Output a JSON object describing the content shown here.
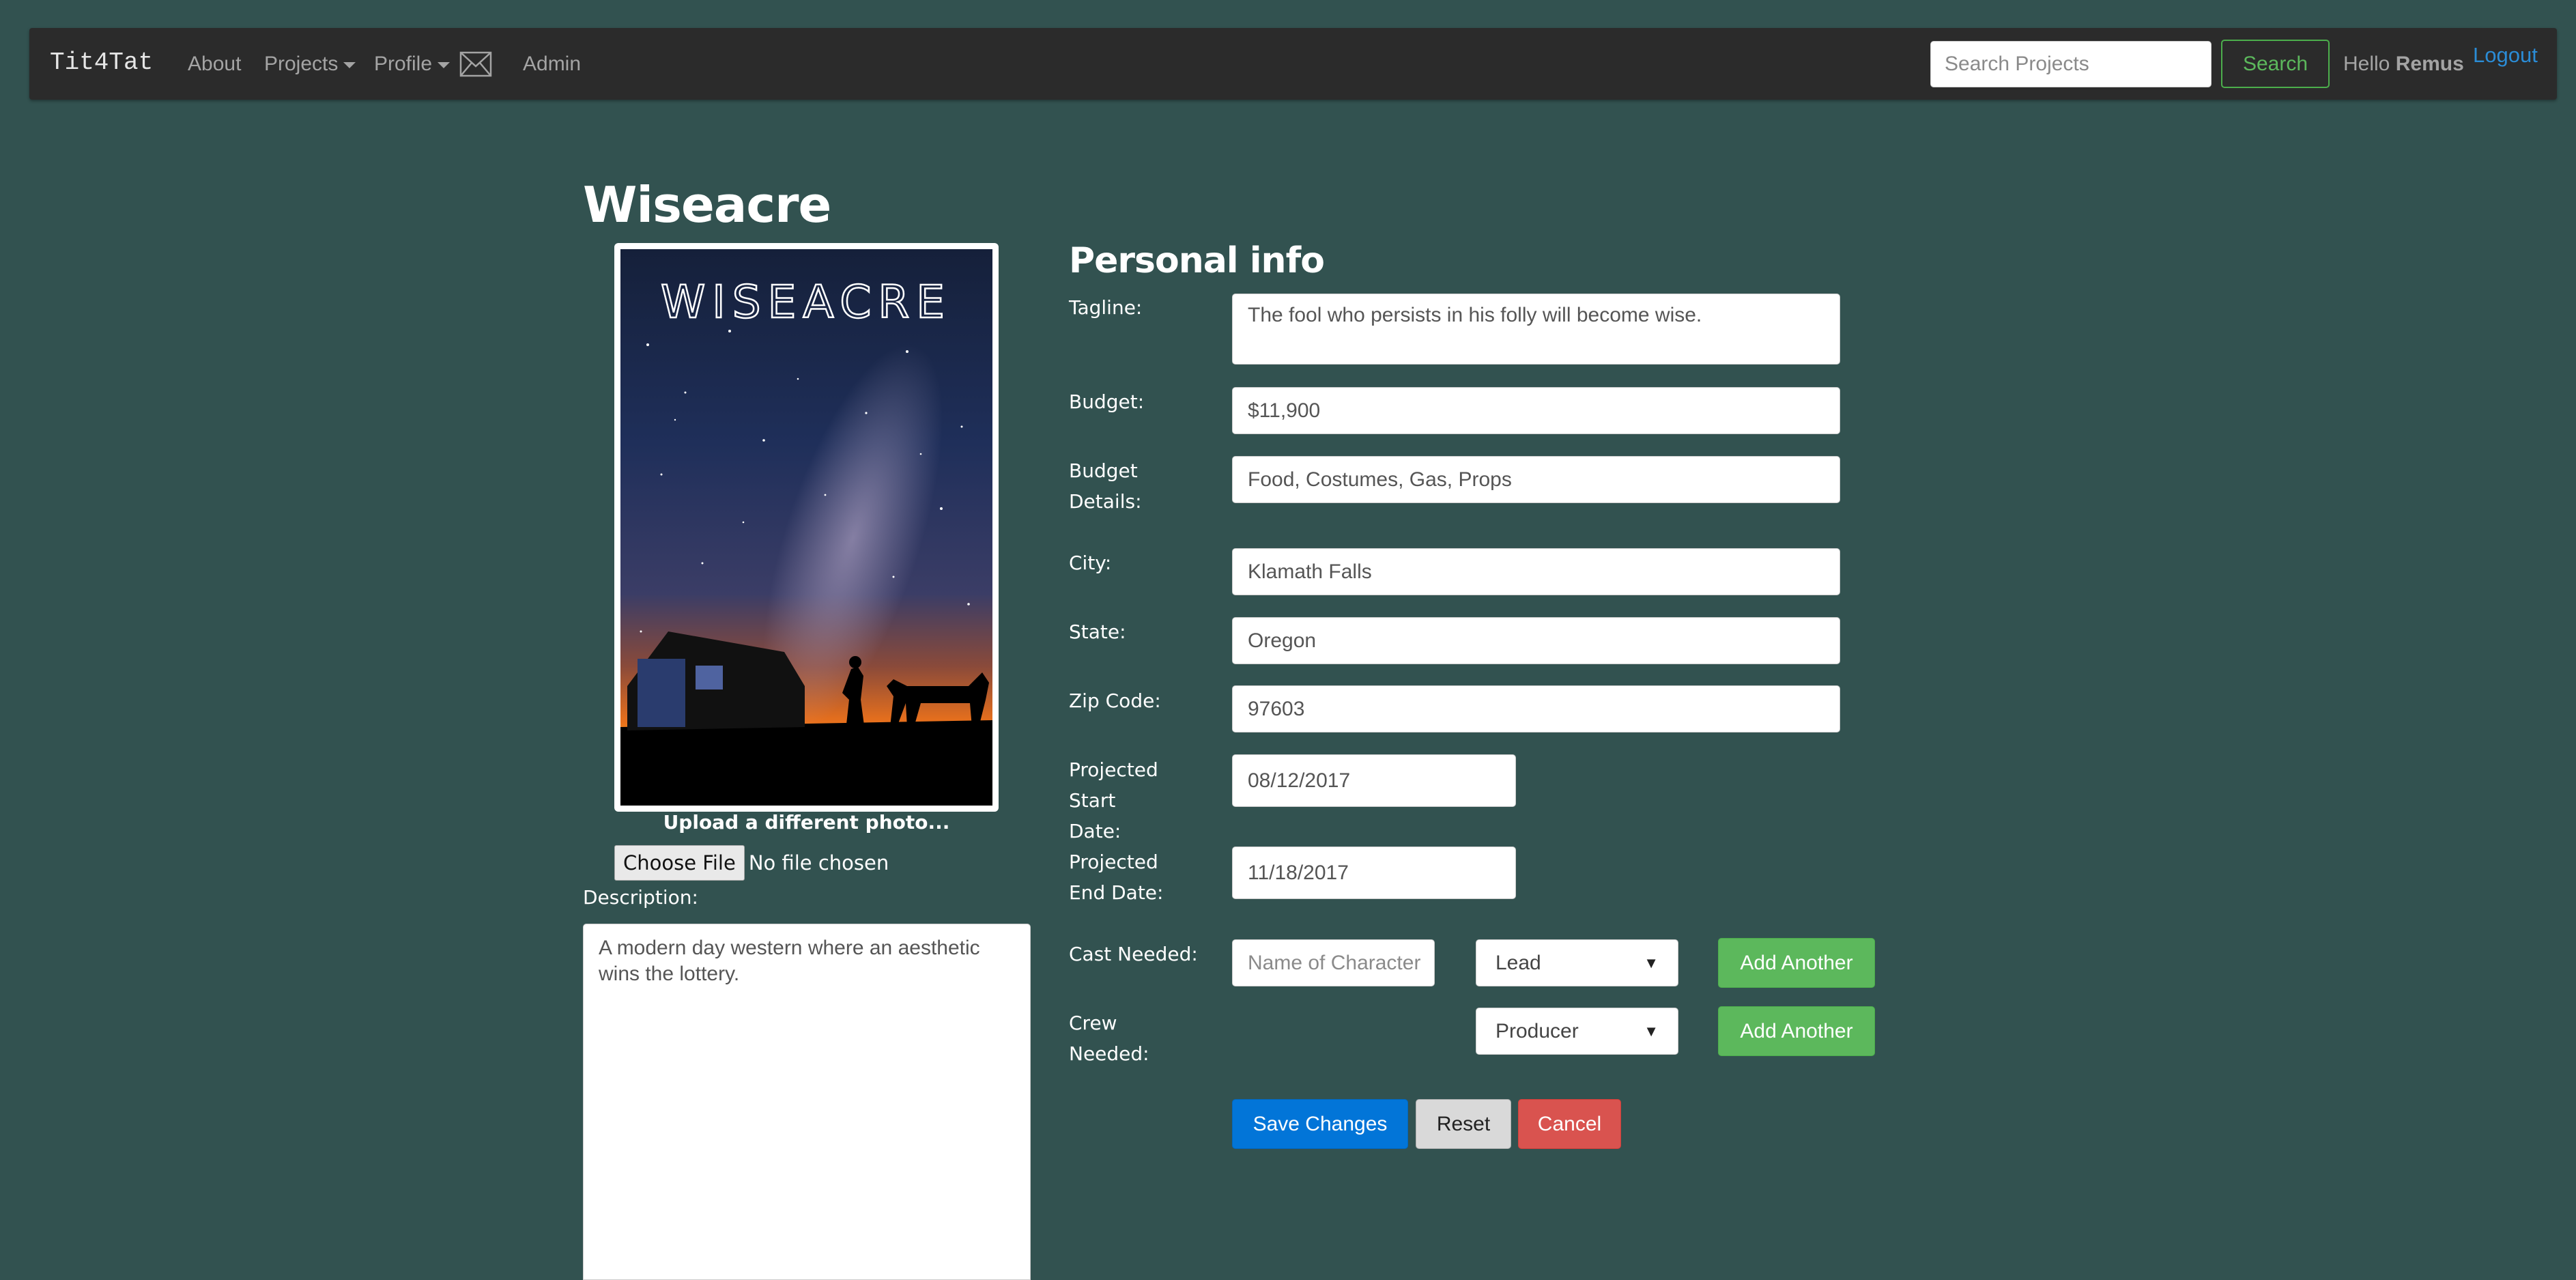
{
  "nav": {
    "brand": "Tit4Tat",
    "about": "About",
    "projects": "Projects",
    "profile": "Profile",
    "admin": "Admin",
    "search_placeholder": "Search Projects",
    "search_label": "Search",
    "hello": "Hello",
    "username": "Remus",
    "logout": "Logout"
  },
  "project": {
    "title": "Wiseacre",
    "poster_title": "WISEACRE",
    "upload_label": "Upload a different photo...",
    "choose_file": "Choose File",
    "no_file": "No file chosen",
    "description_label": "Description:",
    "description": "A modern day western where an aesthetic wins the lottery."
  },
  "form": {
    "heading": "Personal info",
    "tagline_label": "Tagline:",
    "tagline": "The fool who persists in his folly will become wise.",
    "budget_label": "Budget:",
    "budget": "$11,900",
    "budget_details_label": "Budget Details:",
    "budget_details": "Food, Costumes, Gas, Props",
    "city_label": "City:",
    "city": "Klamath Falls",
    "state_label": "State:",
    "state": "Oregon",
    "zip_label": "Zip Code:",
    "zip": "97603",
    "start_label": "Projected Start Date:",
    "start_date": "08/12/2017",
    "end_label": "Projected End Date:",
    "end_date": "11/18/2017",
    "cast_label": "Cast Needed:",
    "cast_placeholder": "Name of Character",
    "cast_role": "Lead",
    "crew_label": "Crew Needed:",
    "crew_role": "Producer",
    "add_another": "Add Another",
    "save": "Save Changes",
    "reset": "Reset",
    "cancel": "Cancel"
  },
  "colors": {
    "background": "#325250",
    "navbar": "#2b2b2b",
    "green": "#5cb85c",
    "blue": "#0275d8",
    "red": "#d9534f"
  }
}
